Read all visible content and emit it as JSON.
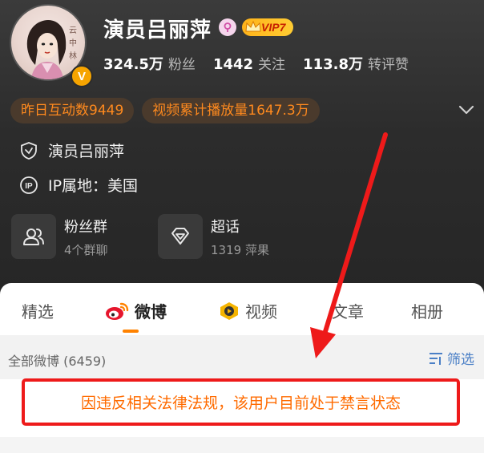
{
  "profile": {
    "name": "演员吕丽萍",
    "vip_label": "VIP7",
    "stats": [
      {
        "value": "324.5万",
        "label": "粉丝"
      },
      {
        "value": "1442",
        "label": "关注"
      },
      {
        "value": "113.8万",
        "label": "转评赞"
      }
    ],
    "pills": [
      "昨日互动数9449",
      "视频累计播放量1647.3万"
    ],
    "verification_text": "演员吕丽萍",
    "ip_location": "IP属地：美国",
    "avatar_calligraphy": "云中林"
  },
  "features": [
    {
      "title": "粉丝群",
      "subtitle": "4个群聊",
      "icon": "fans-group-icon"
    },
    {
      "title": "超话",
      "subtitle": "1319 萍果",
      "icon": "supertopic-icon"
    }
  ],
  "tabs": [
    {
      "label": "精选",
      "active": false
    },
    {
      "label": "微博",
      "active": true
    },
    {
      "label": "视频",
      "active": false
    },
    {
      "label": "文章",
      "active": false
    },
    {
      "label": "相册",
      "active": false
    }
  ],
  "list": {
    "all_weibo_label": "全部微博 (6459)",
    "filter_label": "筛选"
  },
  "notice": {
    "text": "因违反相关法律法规，该用户目前处于禁言状态"
  },
  "colors": {
    "accent_orange": "#ff8200",
    "notice_text": "#ff6b00",
    "annotation_red": "#ee1a1a",
    "link_blue": "#4a7fc6",
    "vip_gold": "#ffb31a"
  }
}
